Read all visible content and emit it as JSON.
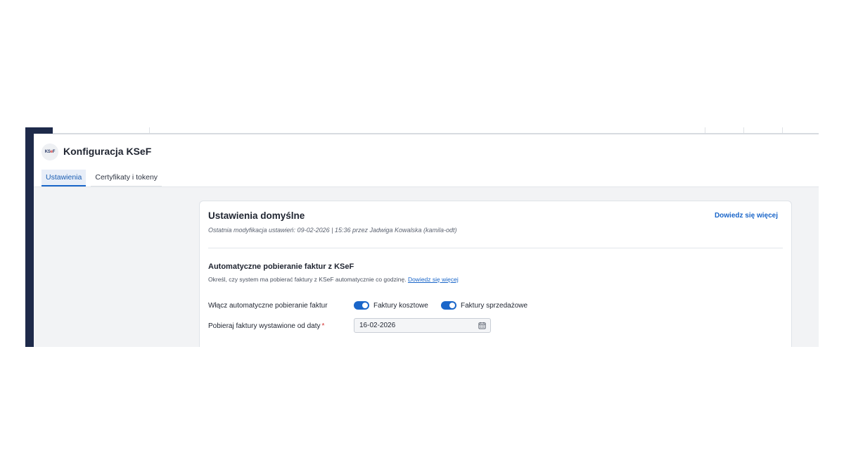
{
  "header": {
    "logo_text_a": "KS",
    "logo_text_e": "e",
    "logo_text_b": "F",
    "title": "Konfiguracja KSeF"
  },
  "tabs": [
    {
      "label": "Ustawienia",
      "active": true
    },
    {
      "label": "Certyfikaty i tokeny",
      "active": false
    }
  ],
  "card": {
    "title": "Ustawienia domyślne",
    "subtitle": "Ostatnia modyfikacja ustawień: 09-02-2026 | 15:36 przez Jadwiga Kowalska (kamila-odt)",
    "learn_more": "Dowiedz się więcej"
  },
  "section": {
    "title": "Automatyczne pobieranie faktur z KSeF",
    "description": "Określ, czy system ma pobierać faktury z KSeF automatycznie co godzinę.",
    "description_link": "Dowiedz się więcej",
    "auto_label": "Włącz automatyczne pobieranie faktur",
    "toggle_cost": {
      "label": "Faktury kosztowe",
      "on": true
    },
    "toggle_sales": {
      "label": "Faktury sprzedażowe",
      "on": true
    },
    "date_label": "Pobieraj faktury wystawione od daty",
    "required_mark": "*",
    "date_value": "16-02-2026"
  },
  "colors": {
    "accent": "#1a66c9",
    "rail": "#1e2a4a",
    "required": "#d32f2f"
  },
  "icons": {
    "date_picker": "calendar-icon"
  }
}
